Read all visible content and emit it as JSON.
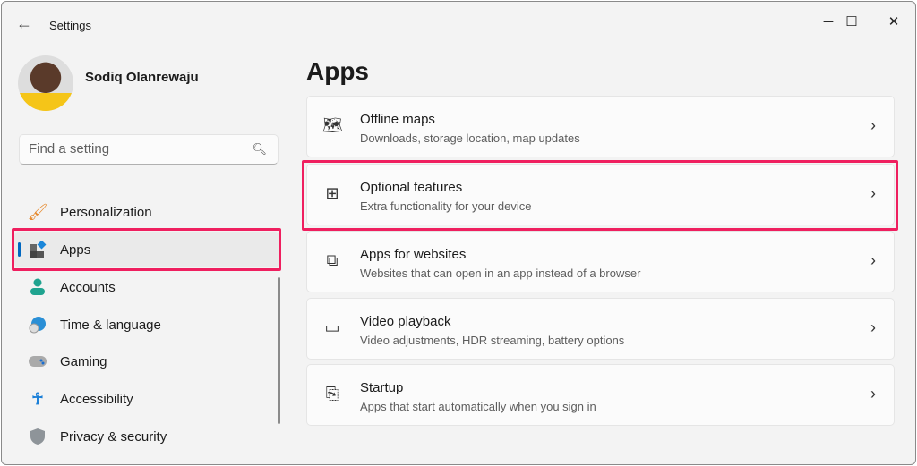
{
  "window": {
    "title": "Settings"
  },
  "user": {
    "name": "Sodiq Olanrewaju"
  },
  "search": {
    "placeholder": "Find a setting"
  },
  "sidebar": {
    "items": [
      {
        "label": "Personalization",
        "icon": "paintbrush-icon"
      },
      {
        "label": "Apps",
        "icon": "apps-icon",
        "selected": true
      },
      {
        "label": "Accounts",
        "icon": "person-icon"
      },
      {
        "label": "Time & language",
        "icon": "globe-clock-icon"
      },
      {
        "label": "Gaming",
        "icon": "gamepad-icon"
      },
      {
        "label": "Accessibility",
        "icon": "accessibility-icon"
      },
      {
        "label": "Privacy & security",
        "icon": "shield-icon"
      }
    ]
  },
  "main": {
    "title": "Apps",
    "cards": [
      {
        "title": "Offline maps",
        "subtitle": "Downloads, storage location, map updates",
        "icon": "map-download-icon"
      },
      {
        "title": "Optional features",
        "subtitle": "Extra functionality for your device",
        "icon": "add-grid-icon"
      },
      {
        "title": "Apps for websites",
        "subtitle": "Websites that can open in an app instead of a browser",
        "icon": "open-link-icon"
      },
      {
        "title": "Video playback",
        "subtitle": "Video adjustments, HDR streaming, battery options",
        "icon": "video-icon"
      },
      {
        "title": "Startup",
        "subtitle": "Apps that start automatically when you sign in",
        "icon": "startup-icon"
      }
    ]
  },
  "colors": {
    "highlight": "#ef1f5f",
    "accent": "#0067c0"
  }
}
